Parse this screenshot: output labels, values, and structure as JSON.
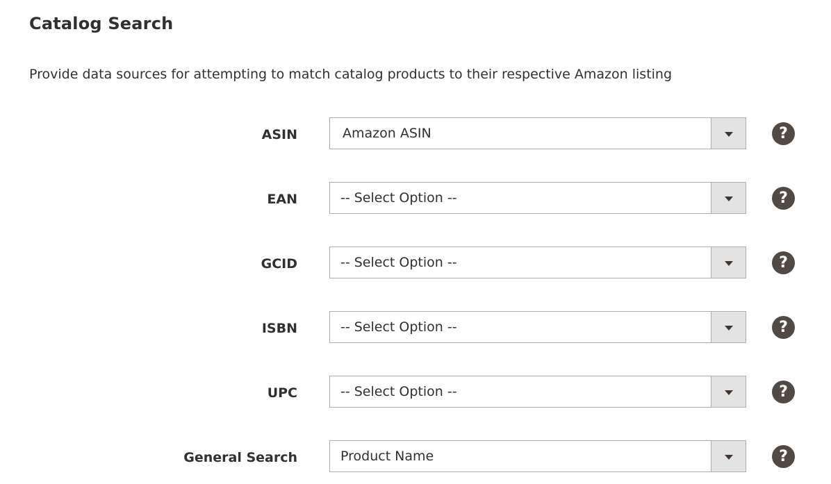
{
  "section": {
    "title": "Catalog Search",
    "description": "Provide data sources for attempting to match catalog products to their respective Amazon listing"
  },
  "fields": [
    {
      "label": "ASIN",
      "value": "Amazon ASIN"
    },
    {
      "label": "EAN",
      "value": "-- Select Option --"
    },
    {
      "label": "GCID",
      "value": "-- Select Option --"
    },
    {
      "label": "ISBN",
      "value": "-- Select Option --"
    },
    {
      "label": "UPC",
      "value": "-- Select Option --"
    },
    {
      "label": "General Search",
      "value": "Product Name"
    }
  ],
  "help_icon_glyph": "?",
  "icons": {
    "dropdown": "chevron-down-icon",
    "help": "help-icon"
  },
  "colors": {
    "text": "#303030",
    "select_border": "#adadad",
    "arrow_bg": "#e3e3e3",
    "help_bg": "#514943"
  }
}
